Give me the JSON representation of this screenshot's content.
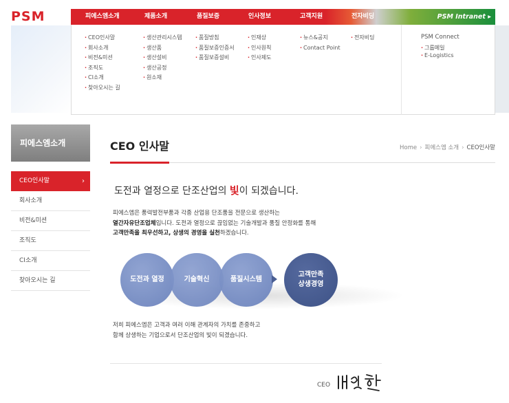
{
  "logo": "PSM",
  "topnav": {
    "items": [
      "피에스엠소개",
      "제품소개",
      "품질보증",
      "인사정보",
      "고객지원",
      "전자비딩"
    ],
    "intranet": "PSM Intranet ▸"
  },
  "mega": {
    "columns": [
      [
        "CEO인사말",
        "회사소개",
        "비전&미션",
        "조직도",
        "CI소개",
        "찾아오시는 길"
      ],
      [
        "생산관리시스템",
        "생산품",
        "생산설비",
        "생산공정",
        "원소재"
      ],
      [
        "품질방침",
        "품질보증인증서",
        "품질보증설비"
      ],
      [
        "인재상",
        "인사원칙",
        "인사제도"
      ],
      [
        "뉴스&공지",
        "Contact Point"
      ],
      [
        "전자비딩"
      ]
    ],
    "psm_connect": {
      "title": "PSM Connect",
      "items": [
        "그룹메일",
        "E-Logistics"
      ]
    }
  },
  "sidebar": {
    "title": "피에스엠소개",
    "items": [
      "CEO인사말",
      "회사소개",
      "비전&미션",
      "조직도",
      "CI소개",
      "찾아오시는 길"
    ],
    "active_chevron": "›"
  },
  "page": {
    "title": "CEO 인사말",
    "breadcrumb": [
      "Home",
      "피에스엠 소개",
      "CEO인사말"
    ],
    "headline_before": "도전과 열정으로 단조산업의 ",
    "headline_hi": "빛",
    "headline_after": "이 되겠습니다.",
    "intro": {
      "line1": "피에스엠은 풍력발전부품과 각종 산업용 단조품을 전문으로 생산하는",
      "line2_bold": "열간자유단조업체",
      "line2_rest": "입니다. 도전과 열정으로 끊임없는 기술개발과 품질 안정화를 통해",
      "line3_b1": "고객만족을 최우선하고, 상생의 경영을 실천",
      "line3_rest": "하겠습니다."
    },
    "circles": [
      "도전과 열정",
      "기술혁신",
      "품질시스템"
    ],
    "result_line1": "고객만족",
    "result_line2": "상생경영",
    "closing": {
      "line1": "저희 피에스엠은 고객과 여러 이해 관계자의 가치를 존중하고",
      "line2": "함께 상생하는 기업으로서 단조산업의 빛이 되겠습니다."
    },
    "ceo_label": "CEO"
  }
}
